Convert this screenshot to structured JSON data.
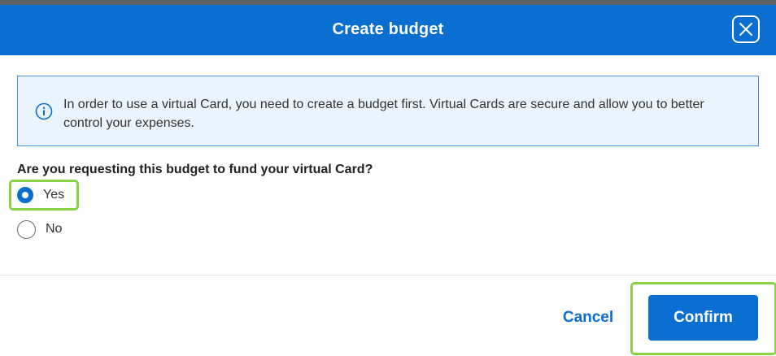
{
  "dialog": {
    "title": "Create budget",
    "close_icon": "close-icon"
  },
  "info": {
    "icon": "info-icon",
    "text": "In order to use a virtual Card, you need to create a budget first. Virtual Cards are secure and allow you to better control your expenses."
  },
  "question": {
    "label": "Are you requesting this budget to fund your virtual Card?",
    "options": [
      {
        "label": "Yes",
        "selected": true
      },
      {
        "label": "No",
        "selected": false
      }
    ]
  },
  "footer": {
    "cancel_label": "Cancel",
    "confirm_label": "Confirm"
  },
  "colors": {
    "header": "#0a6fd1",
    "highlight": "#8ad14a",
    "info_bg": "#eaf4fd",
    "info_border": "#4a90d0"
  }
}
